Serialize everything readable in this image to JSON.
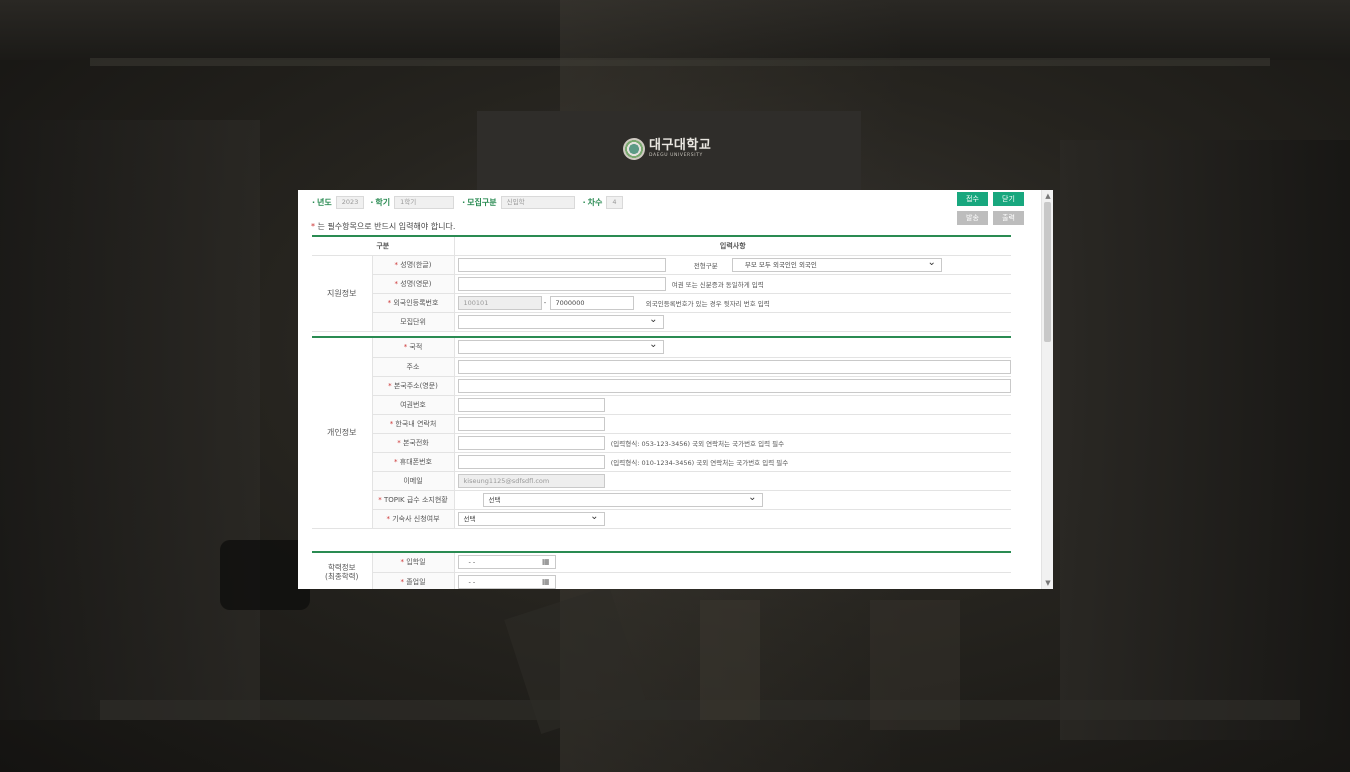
{
  "logo": {
    "korean": "대구대학교",
    "english": "DAEGU UNIVERSITY"
  },
  "topbar": {
    "year_label": "년도",
    "year_value": "2023",
    "term_label": "학기",
    "term_value": "1학기",
    "recruit_label": "모집구분",
    "recruit_value": "신입학",
    "round_label": "차수",
    "round_value": "4"
  },
  "buttons": {
    "submit": "접수",
    "close": "닫기",
    "print": "발송",
    "withdraw": "출력"
  },
  "notice": {
    "star": "*",
    "text": "는 필수항목으로 반드시 입력해야 합니다."
  },
  "headers": {
    "division": "구분",
    "input": "입력사항"
  },
  "sections": {
    "apply": "지원정보",
    "personal": "개인정보",
    "academic_line1": "학력정보",
    "academic_line2": "(최종학력)"
  },
  "apply": {
    "name_kr_label": "성명(한글)",
    "name_kr_value": "",
    "type_label": "전형구분",
    "type_value": "부모 모두 외국인인 외국인",
    "name_en_label": "성명(영문)",
    "name_en_value": "",
    "name_en_hint": "여권 또는 신분증과 동일하게 입력",
    "regno_label": "외국인등록번호",
    "regno_front": "100101",
    "regno_dash": "-",
    "regno_back": "7000000",
    "regno_hint": "외국인등록번호가 있는 경우 뒷자리 번호 입력",
    "unit_label": "모집단위",
    "unit_value": ""
  },
  "personal": {
    "nationality_label": "국적",
    "address_label": "주소",
    "home_address_label": "본국주소(영문)",
    "passport_label": "여권번호",
    "korea_contact_label": "한국내 연락처",
    "home_phone_label": "본국전화",
    "home_phone_hint": "(입력형식: 053-123-3456) 국외 연락처는 국가번호 입력 필수",
    "mobile_label": "휴대폰번호",
    "mobile_hint": "(입력형식: 010-1234-3456) 국외 연락처는 국가번호 입력 필수",
    "email_label": "이메일",
    "email_value": "kiseung1125@sdfsdfl.com",
    "topik_label": "TOPIK 급수 소지현황",
    "topik_value": "선택",
    "dorm_label": "기숙사 신청여부",
    "dorm_value": "선택"
  },
  "academic": {
    "entry_label": "입학일",
    "entry_value": "- -",
    "grad_label": "졸업일",
    "grad_value": "- -"
  },
  "colors": {
    "accent": "#2a8b52",
    "button": "#18a77e"
  },
  "icons": [
    "calendar-icon",
    "chevron-down-icon",
    "scroll-up-icon",
    "scroll-down-icon"
  ]
}
